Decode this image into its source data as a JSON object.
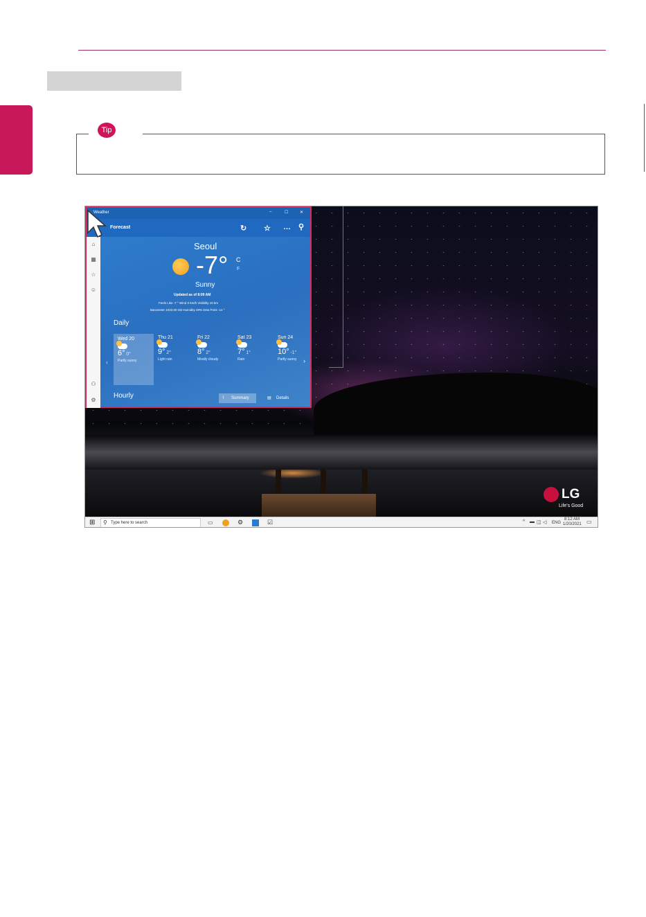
{
  "tip": {
    "badge": "Tip"
  },
  "weather_app": {
    "title": "Weather",
    "header_title": "Forecast",
    "window_buttons": [
      "–",
      "☐",
      "✕"
    ],
    "city": "Seoul",
    "temperature": "-7°",
    "unit_c": "C",
    "unit_f": "F",
    "condition": "Sunny",
    "updated": "Updated as of 8:09 AM",
    "details_line1": "Feels Like  -7 °     Wind    0 km/h     Visibility   10 km",
    "details_line2": "Barometer  1032.00 mb     Humidity  49%     Dew Point  -14 °",
    "daily_label": "Daily",
    "hourly_label": "Hourly",
    "days": [
      {
        "name": "Wed 20",
        "high": "6°",
        "low": "0°",
        "cond": "Partly sunny"
      },
      {
        "name": "Thu 21",
        "high": "9°",
        "low": "2°",
        "cond": "Light rain"
      },
      {
        "name": "Fri 22",
        "high": "8°",
        "low": "2°",
        "cond": "Mostly cloudy"
      },
      {
        "name": "Sat 23",
        "high": "7°",
        "low": "1°",
        "cond": "Rain"
      },
      {
        "name": "Sun 24",
        "high": "10°",
        "low": "-1°",
        "cond": "Partly sunny"
      }
    ],
    "summary_button": "Summary",
    "details_button": "Details"
  },
  "taskbar": {
    "search_placeholder": "Type here to search",
    "lang": "ENG",
    "time": "8:12 AM",
    "date": "1/20/2021"
  },
  "logo": {
    "brand": "LG",
    "slogan": "Life's Good"
  },
  "colors": {
    "accent": "#c8185a",
    "window_blue": "#2a6fc0",
    "highlight": "#d92b5b"
  }
}
